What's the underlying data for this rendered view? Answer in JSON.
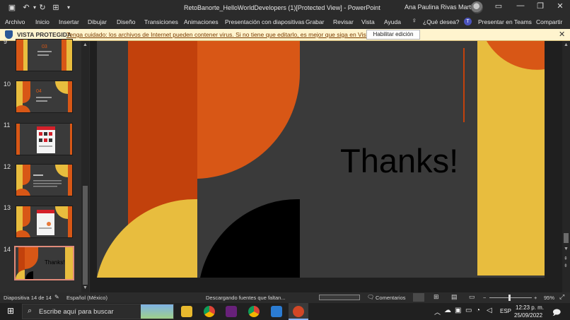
{
  "window": {
    "title": "RetoBanorte_HelloWorldDevelopers (1)[Protected View]  -  PowerPoint",
    "user": "Ana Paulina Rivas Martinez",
    "quick_access": [
      "save-icon",
      "undo-icon",
      "redo-icon",
      "customize-icon",
      "more-icon"
    ]
  },
  "ribbon": {
    "tabs": [
      "Archivo",
      "Inicio",
      "Insertar",
      "Dibujar",
      "Diseño",
      "Transiciones",
      "Animaciones",
      "Presentación con diapositivas",
      "Grabar",
      "Revisar",
      "Vista",
      "Ayuda"
    ],
    "tell_me": "¿Qué desea?",
    "present_teams": "Presentar en Teams",
    "share": "Compartir"
  },
  "protected_view": {
    "label": "VISTA PROTEGIDA",
    "message": "Tenga cuidado: los archivos de Internet pueden contener virus. Si no tiene que editarlo, es mejor que siga en Vista protegida.",
    "button": "Habilitar edición"
  },
  "thumbnails": [
    {
      "num": "9",
      "caption": "03"
    },
    {
      "num": "10",
      "caption": "04"
    },
    {
      "num": "11",
      "caption": ""
    },
    {
      "num": "12",
      "caption": ""
    },
    {
      "num": "13",
      "caption": ""
    },
    {
      "num": "14",
      "caption": "Thanks!"
    }
  ],
  "slide": {
    "title": "Thanks!",
    "colors": {
      "orange": "#d85716",
      "yellow": "#e8bd3e",
      "dark": "#3a3a3a",
      "black": "#000000",
      "rust": "#c2410c"
    }
  },
  "status": {
    "slide_info": "Diapositiva 14 de 14",
    "language": "Español (México)",
    "message": "Descargando fuentes que faltan...",
    "comments": "Comentarios",
    "zoom": "95%"
  },
  "taskbar": {
    "search_placeholder": "Escribe aquí para buscar",
    "lang": "ESP",
    "time": "12:23 p. m.",
    "date": "25/09/2022"
  }
}
